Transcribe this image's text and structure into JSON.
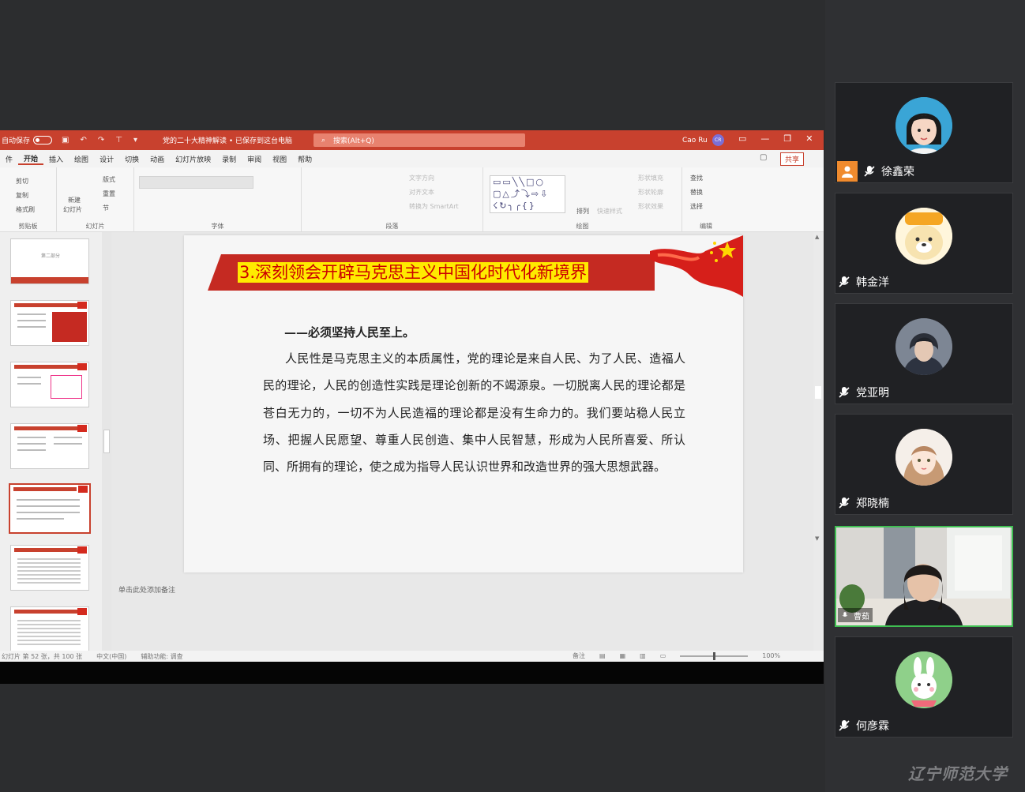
{
  "titlebar": {
    "autosave": "自动保存",
    "doc_title": "党的二十大精神解读 • 已保存到这台电脑",
    "search_placeholder": "搜索(Alt+Q)",
    "user_name": "Cao Ru",
    "user_initials": "CR"
  },
  "menu": [
    "件",
    "开始",
    "插入",
    "绘图",
    "设计",
    "切换",
    "动画",
    "幻灯片放映",
    "录制",
    "审阅",
    "视图",
    "帮助"
  ],
  "share_label": "共享",
  "ribbon": {
    "clipboard": {
      "cut": "剪切",
      "copy": "复制",
      "format": "格式刷",
      "label": "剪贴板"
    },
    "slides": {
      "new": "新建",
      "new2": "幻灯片",
      "layout": "版式",
      "reset": "重置",
      "section": "节",
      "label": "幻灯片"
    },
    "font": {
      "label": "字体"
    },
    "paragraph": {
      "textdir": "文字方向",
      "align": "对齐文本",
      "smartart": "转换为 SmartArt",
      "label": "段落"
    },
    "drawing": {
      "arrange": "排列",
      "quick": "快速样式",
      "fill": "形状填充",
      "outline": "形状轮廓",
      "effect": "形状效果",
      "label": "绘图"
    },
    "editing": {
      "find": "查找",
      "replace": "替换",
      "select": "选择",
      "label": "编辑"
    }
  },
  "thumbnails": [
    {
      "num": "",
      "title": "第二部分"
    },
    {
      "num": "",
      "title": ""
    },
    {
      "num": "",
      "title": ""
    },
    {
      "num": "",
      "title": ""
    },
    {
      "num": "",
      "title": ""
    },
    {
      "num": "",
      "title": ""
    },
    {
      "num": "",
      "title": ""
    }
  ],
  "slide": {
    "title": "3.深刻领会开辟马克思主义中国化时代化新境界",
    "subheading": "——必须坚持人民至上。",
    "body": "人民性是马克思主义的本质属性，党的理论是来自人民、为了人民、造福人民的理论，人民的创造性实践是理论创新的不竭源泉。一切脱离人民的理论都是苍白无力的，一切不为人民造福的理论都是没有生命力的。我们要站稳人民立场、把握人民愿望、尊重人民创造、集中人民智慧，形成为人民所喜爱、所认同、所拥有的理论，使之成为指导人民认识世界和改造世界的强大思想武器。"
  },
  "notes_placeholder": "单击此处添加备注",
  "status": {
    "slide_count": "幻灯片 第 52 张，共 100 张",
    "language": "中文(中国)",
    "accessibility": "辅助功能: 调查",
    "notes": "备注",
    "zoom": "100%"
  },
  "participants": [
    {
      "name": "徐鑫荣",
      "host": true
    },
    {
      "name": "韩金洋",
      "host": false
    },
    {
      "name": "党亚明",
      "host": false
    },
    {
      "name": "郑晓楠",
      "host": false
    },
    {
      "name": "曹茹",
      "host": false,
      "video": true
    },
    {
      "name": "何彦霖",
      "host": false
    }
  ],
  "watermark": "辽宁师范大学",
  "colors": {
    "accent": "#c8412e",
    "active_speaker": "#3fbf52"
  }
}
